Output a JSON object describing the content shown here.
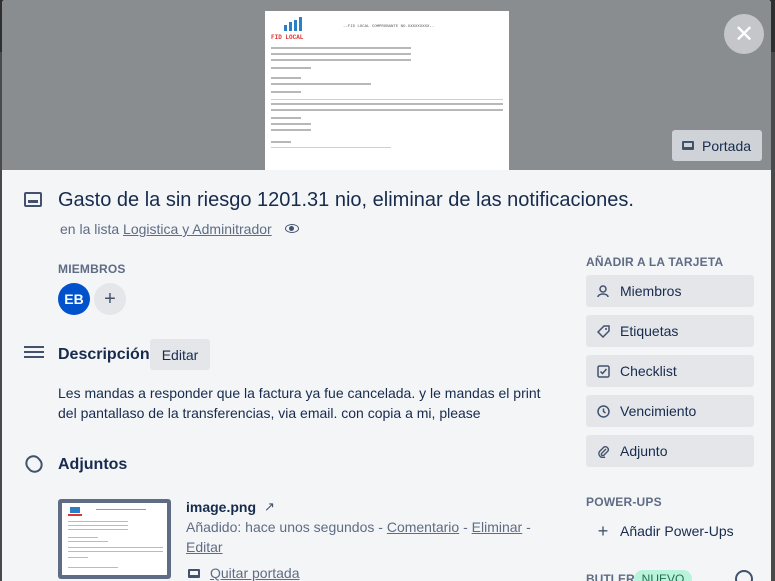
{
  "cover": {
    "portada_label": "Portada",
    "doc_title": "--FID LOCAL COMPROBANTE NO.XXXXXXXXX--",
    "logo_text": "FID LOCAL"
  },
  "card": {
    "title": "Gasto de la sin riesgo 1201.31 nio, eliminar de las notificaciones.",
    "in_list_prefix": "en la lista",
    "list_name": "Logistica y Adminitrador"
  },
  "members": {
    "label": "MIEMBROS",
    "avatar_initials": "EB"
  },
  "description": {
    "title": "Descripción",
    "edit_label": "Editar",
    "text": "Les mandas a responder que la factura ya fue cancelada. y le mandas el print del pantallaso de la transferencias, via email. con copia a mi, please"
  },
  "attachments": {
    "title": "Adjuntos",
    "item": {
      "name": "image.png",
      "added_prefix": "Añadido: hace unos segundos -",
      "comment": "Comentario",
      "sep": "-",
      "delete": "Eliminar",
      "sep2": "-",
      "edit": "Editar",
      "remove_cover": "Quitar portada"
    }
  },
  "sidebar": {
    "add_label": "AÑADIR A LA TARJETA",
    "buttons": [
      {
        "label": "Miembros",
        "icon": "person-icon"
      },
      {
        "label": "Etiquetas",
        "icon": "tag-icon"
      },
      {
        "label": "Checklist",
        "icon": "checkbox-icon"
      },
      {
        "label": "Vencimiento",
        "icon": "clock-icon"
      },
      {
        "label": "Adjunto",
        "icon": "paperclip-icon"
      }
    ],
    "powerups_label": "POWER-UPS",
    "powerups_add": "Añadir Power-Ups",
    "butler_label": "BUTLER",
    "butler_badge": "NUEVO"
  },
  "colors": {
    "avatar": "#0052cc",
    "modal_bg": "#f4f5f7",
    "button_bg": "#e4e6ea",
    "badge_bg": "#baf3db"
  }
}
